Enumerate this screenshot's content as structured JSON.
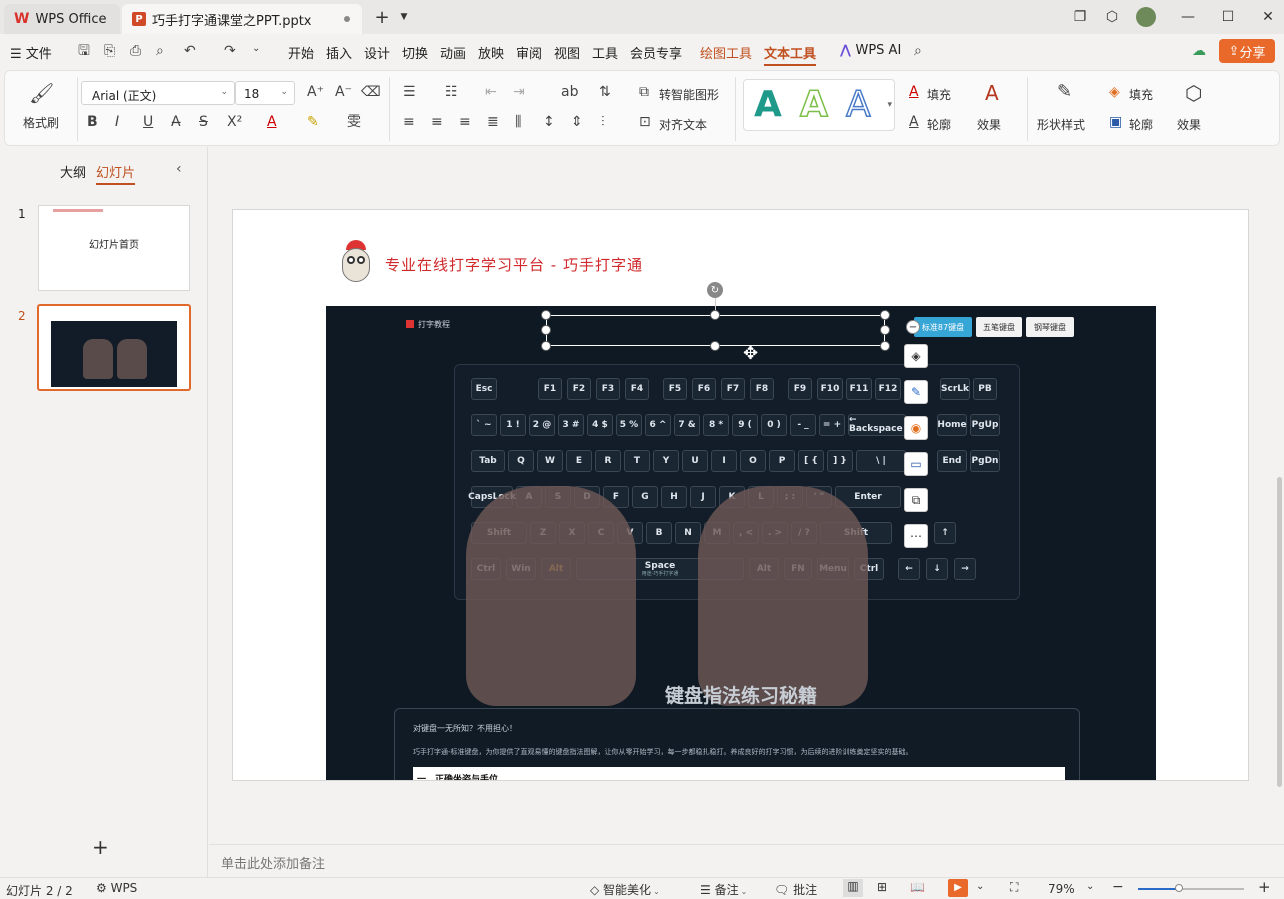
{
  "titlebar": {
    "app_tab": "WPS Office",
    "doc_tab": "巧手打字通课堂之PPT.pptx"
  },
  "menubar": {
    "file": "文件",
    "items": [
      "开始",
      "插入",
      "设计",
      "切换",
      "动画",
      "放映",
      "审阅",
      "视图",
      "工具",
      "会员专享"
    ],
    "drawing_tools": "绘图工具",
    "text_tools": "文本工具",
    "wps_ai": "WPS AI",
    "share": "分享"
  },
  "ribbon": {
    "format_painter": "格式刷",
    "font_name": "Arial (正文)",
    "font_size": "18",
    "smart_shape": "转智能图形",
    "align_text": "对齐文本",
    "text_fill": "填充",
    "text_outline": "轮廓",
    "text_effect": "效果",
    "shape_style": "形状样式",
    "shape_fill": "填充",
    "shape_outline": "轮廓",
    "shape_effect": "效果"
  },
  "left_panel": {
    "tab_outline": "大纲",
    "tab_slides": "幻灯片",
    "slides": [
      {
        "number": "1",
        "caption": "幻灯片首页"
      },
      {
        "number": "2",
        "caption": ""
      }
    ]
  },
  "slide": {
    "header": "专业在线打字学习平台 - 巧手打字通",
    "screenshot": {
      "logo_text": "打字教程",
      "tab_standard": "标准87键盘",
      "tab_wubi": "五笔键盘",
      "tab_piano": "钢琴键盘",
      "banner_title": "键盘指法练习秘籍",
      "intro_1": "对键盘一无所知？不用担心！",
      "intro_2": "巧手打字通-标准键盘，为你提供了直观易懂的键盘指法图解，让你从零开始学习，每一步都稳扎稳打。养成良好的打字习惯，为后续的进阶训练奠定坚实的基础。",
      "section_1": "一、正确坐姿与手位",
      "space_sub": "用途-巧手打字通"
    }
  },
  "notes_placeholder": "单击此处添加备注",
  "statusbar": {
    "slide_counter": "幻灯片 2 / 2",
    "wps": "WPS",
    "smart_beautify": "智能美化",
    "notes": "备注",
    "comments": "批注",
    "zoom": "79%"
  },
  "colors": {
    "accent": "#c0501f",
    "share_bg": "#e8692a",
    "slide_header": "#d0282b",
    "selected_thumb": "#e0692b"
  }
}
